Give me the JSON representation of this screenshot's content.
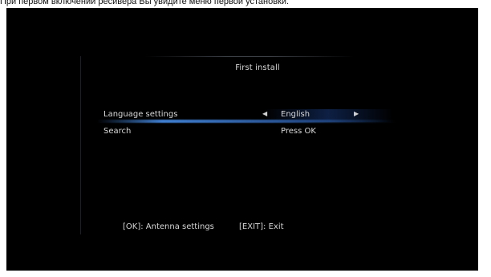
{
  "caption": "При первом включении ресивера Вы увидите меню первой установки.",
  "screen": {
    "title": "First install",
    "rows": [
      {
        "label": "Language settings",
        "value": "English"
      },
      {
        "label": "Search",
        "value": "Press OK"
      }
    ],
    "footer": {
      "ok_hint": "[OK]: Antenna settings",
      "exit_hint": "[EXIT]: Exit"
    }
  },
  "icons": {
    "left_arrow": "triangle-left",
    "right_arrow": "triangle-right"
  },
  "colors": {
    "background": "#000000",
    "text": "#d9d9d9",
    "highlight": "#4a8ce6"
  }
}
